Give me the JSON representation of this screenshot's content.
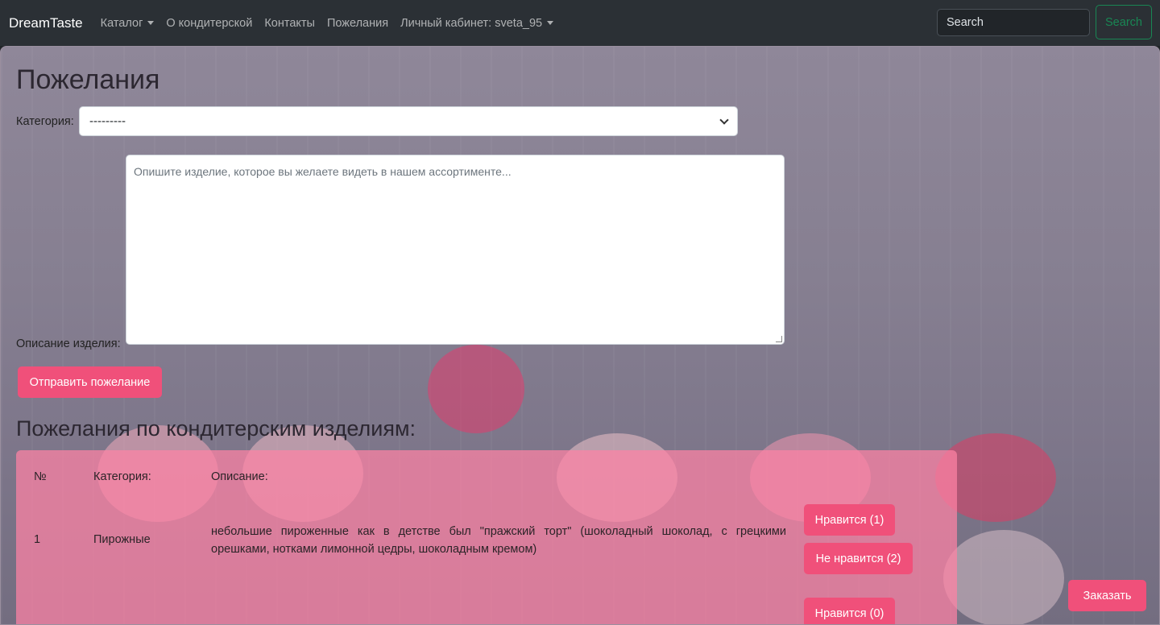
{
  "navbar": {
    "brand": "DreamTaste",
    "items": [
      {
        "label": "Каталог",
        "dropdown": true
      },
      {
        "label": "О кондитерской",
        "dropdown": false
      },
      {
        "label": "Контакты",
        "dropdown": false
      },
      {
        "label": "Пожелания",
        "dropdown": false
      },
      {
        "label": "Личный кабинет: sveta_95",
        "dropdown": true
      }
    ],
    "search_placeholder": "Search",
    "search_button": "Search"
  },
  "form": {
    "title": "Пожелания",
    "category_label": "Категория:",
    "category_value": "---------",
    "description_label": "Описание изделия:",
    "description_placeholder": "Опишите изделие, которое вы желаете видеть в нашем ассортименте...",
    "submit_label": "Отправить пожелание"
  },
  "wishes": {
    "title": "Пожелания по кондитерским изделиям:",
    "headers": [
      "№",
      "Категория:",
      "Описание:"
    ],
    "rows": [
      {
        "num": "1",
        "category": "Пирожные",
        "description": "небольшие пироженные как в детстве был \"пражский торт\" (шоколадный шоколад, с грецкими орешками, нотками лимонной цедры, шоколадным кремом)",
        "like_label": "Нравится (1)",
        "dislike_label": "Не нравится (2)"
      },
      {
        "like_label": "Нравится (0)"
      }
    ]
  },
  "order_button": "Заказать",
  "colors": {
    "navbar": "#2b3035",
    "accent_pink": "#f0507a",
    "search_green": "#198754"
  }
}
